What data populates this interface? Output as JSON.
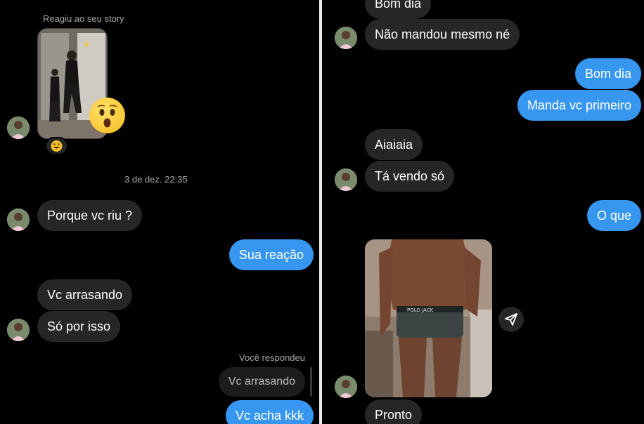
{
  "left": {
    "story_label": "Reagiu ao seu story",
    "reaction_emoji": "astonished-face",
    "reaction_chip_emoji": "grinning-face",
    "timestamp": "3 de dez. 22:35",
    "messages": [
      {
        "side": "in",
        "text": "Porque vc riu ?"
      },
      {
        "side": "out",
        "text": "Sua reação"
      },
      {
        "side": "in",
        "text": "Vc arrasando"
      },
      {
        "side": "in",
        "text": "Só por isso"
      }
    ],
    "reply_label": "Você respondeu",
    "quoted_text": "Vc arrasando",
    "reply_text": "Vc acha kkk"
  },
  "right": {
    "messages": [
      {
        "side": "in",
        "text": "Bom dia"
      },
      {
        "side": "in",
        "text": "Não mandou mesmo né"
      },
      {
        "side": "out",
        "text": "Bom dia"
      },
      {
        "side": "out",
        "text": "Manda vc primeiro"
      },
      {
        "side": "in",
        "text": "Aiaiaia"
      },
      {
        "side": "in",
        "text": "Tá vendo só"
      },
      {
        "side": "out",
        "text": "O que"
      },
      {
        "side": "in",
        "text": "Pronto"
      }
    ],
    "photo_waistband_text": "POLO JACK",
    "share_icon": "send-icon"
  },
  "colors": {
    "background": "#000000",
    "incoming_bubble": "#262626",
    "outgoing_bubble": "#3797f0",
    "meta_text": "#a8a8a8"
  }
}
